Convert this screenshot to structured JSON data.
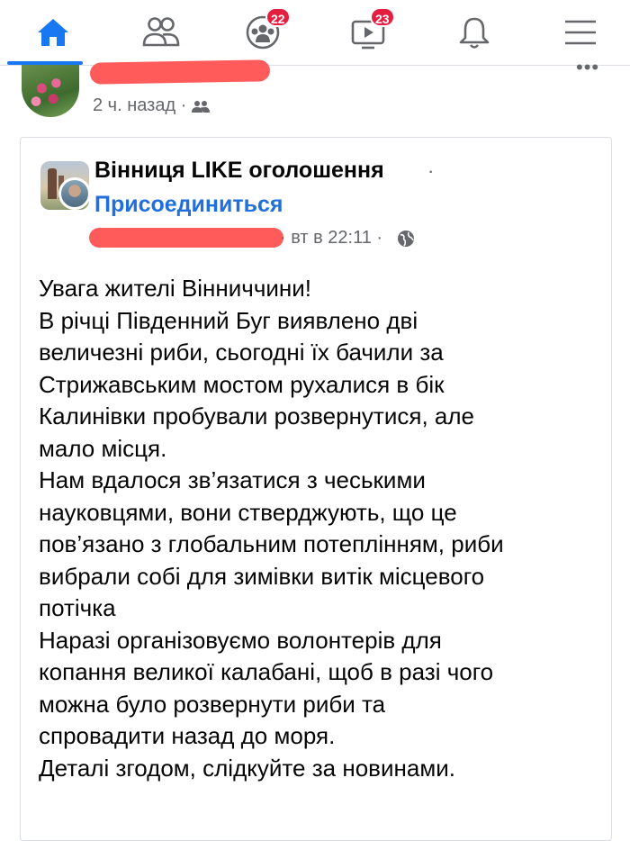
{
  "nav": {
    "items": [
      {
        "name": "home",
        "icon": "home-icon",
        "active": true
      },
      {
        "name": "friends",
        "icon": "friends-icon"
      },
      {
        "name": "groups",
        "icon": "groups-icon",
        "badge": "22"
      },
      {
        "name": "watch",
        "icon": "watch-icon",
        "badge": "23"
      },
      {
        "name": "notifications",
        "icon": "bell-icon"
      },
      {
        "name": "menu",
        "icon": "menu-icon"
      }
    ],
    "accent": "#1877f2",
    "badge_color": "#e41e3f"
  },
  "post": {
    "time": "2 ч. назад · ",
    "audience_icon": "friends-audience-icon",
    "more_icon": "more-dots-icon",
    "more": "•••"
  },
  "shared": {
    "group_name": "Вінниця LIKE  оголошення",
    "separator": "·",
    "join": "Присоединиться",
    "time": "· вт в 22:11 ·",
    "privacy_icon": "globe-icon",
    "join_color": "#216fdb",
    "lines": [
      "Увага жителі Вінниччини!",
      "В річці Південний Буг виявлено дві",
      "величезні риби, сьогодні їх бачили за",
      "Стрижавським мостом рухалися в бік",
      "Калинівки пробували розвернутися, але",
      "мало місця.",
      "Нам вдалося зв’язатися з чеськими",
      "науковцями, вони стверджують, що це",
      "пов’язано з глобальним потеплінням, риби",
      "вибрали собі для зимівки витік місцевого",
      "потічка",
      "Наразі організовуємо волонтерів для",
      "копання великої калабані, щоб в разі чого",
      "можна було розвернути риби та",
      "спровадити назад до моря.",
      "Деталі згодом, слідкуйте за новинами."
    ]
  },
  "redaction_color": "#ff5b5b"
}
